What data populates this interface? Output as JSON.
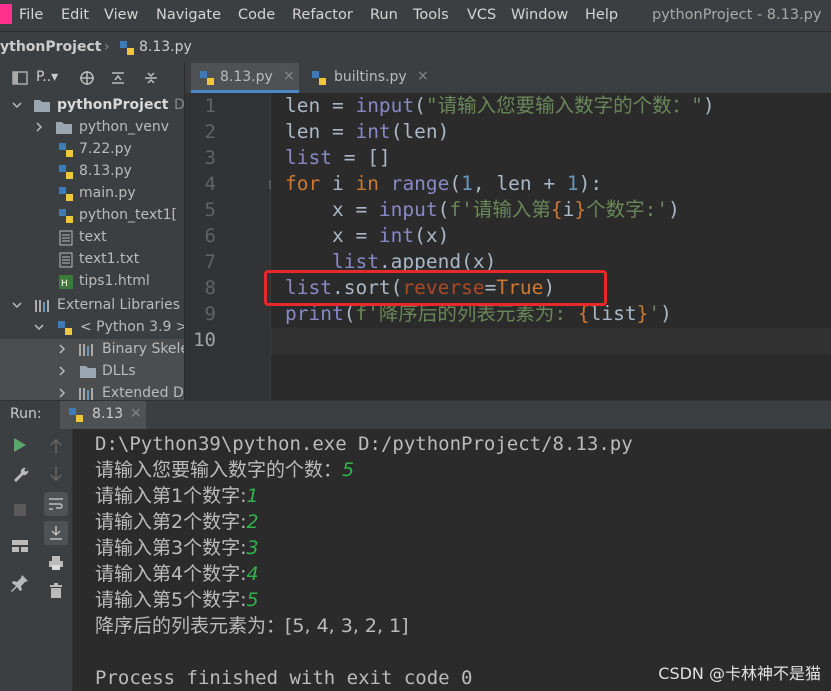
{
  "window": {
    "title": "pythonProject - 8.13.py",
    "menus": [
      "File",
      "Edit",
      "View",
      "Navigate",
      "Code",
      "Refactor",
      "Run",
      "Tools",
      "VCS",
      "Window",
      "Help"
    ]
  },
  "navbar": {
    "project": "ythonProject",
    "file": "8.13.py"
  },
  "project_panel": {
    "selector": "P..▾",
    "tree": [
      {
        "label": "pythonProject",
        "suffix": "D",
        "type": "folder",
        "expanded": true
      },
      {
        "label": "python_venv",
        "type": "folder",
        "expanded": false
      },
      {
        "label": "7.22.py",
        "type": "py"
      },
      {
        "label": "8.13.py",
        "type": "py"
      },
      {
        "label": "main.py",
        "type": "py"
      },
      {
        "label": "python_text1[",
        "type": "py"
      },
      {
        "label": "text",
        "type": "file"
      },
      {
        "label": "text1.txt",
        "type": "file"
      },
      {
        "label": "tips1.html",
        "type": "html"
      },
      {
        "label": "External Libraries",
        "type": "lib",
        "expanded": true
      },
      {
        "label": "< Python 3.9 >",
        "type": "py",
        "expanded": true
      },
      {
        "label": "Binary Skele",
        "type": "lib",
        "expanded": false
      },
      {
        "label": "DLLs",
        "type": "folder",
        "expanded": false
      },
      {
        "label": "Extended D",
        "type": "lib",
        "expanded": false
      }
    ]
  },
  "editor": {
    "tabs": [
      {
        "label": "8.13.py",
        "active": true
      },
      {
        "label": "builtins.py",
        "active": false
      }
    ],
    "line_numbers": [
      "1",
      "2",
      "3",
      "4",
      "5",
      "6",
      "7",
      "8",
      "9",
      "10"
    ],
    "current_line": "10",
    "code": [
      "len = input(\"请输入您要输入数字的个数：\")",
      "len = int(len)",
      "list = []",
      "for i in range(1, len + 1):",
      "    x = input(f'请输入第{i}个数字:')",
      "    x = int(x)",
      "    list.append(x)",
      "list.sort(reverse=True)",
      "print(f'降序后的列表元素为: {list}')",
      ""
    ]
  },
  "run": {
    "label": "Run:",
    "tab": "8.13",
    "console": [
      {
        "text": "D:\\Python39\\python.exe D:/pythonProject/8.13.py",
        "mono": true
      },
      {
        "text": "请输入您要输入数字的个数：",
        "input": "5"
      },
      {
        "text": "请输入第1个数字:",
        "input": "1"
      },
      {
        "text": "请输入第2个数字:",
        "input": "2"
      },
      {
        "text": "请输入第3个数字:",
        "input": "3"
      },
      {
        "text": "请输入第4个数字:",
        "input": "4"
      },
      {
        "text": "请输入第5个数字:",
        "input": "5"
      },
      {
        "text": "降序后的列表元素为：[5, 4, 3, 2, 1]"
      },
      {
        "text": ""
      },
      {
        "text": "Process finished with exit code 0",
        "mono": true
      }
    ]
  },
  "watermark": "CSDN @卡林神不是猫",
  "colors": {
    "highlight_box": "#e8282a",
    "input_text": "#2fb34a",
    "keyword": "#cc7832",
    "string": "#6a8759",
    "number": "#6897bb"
  }
}
